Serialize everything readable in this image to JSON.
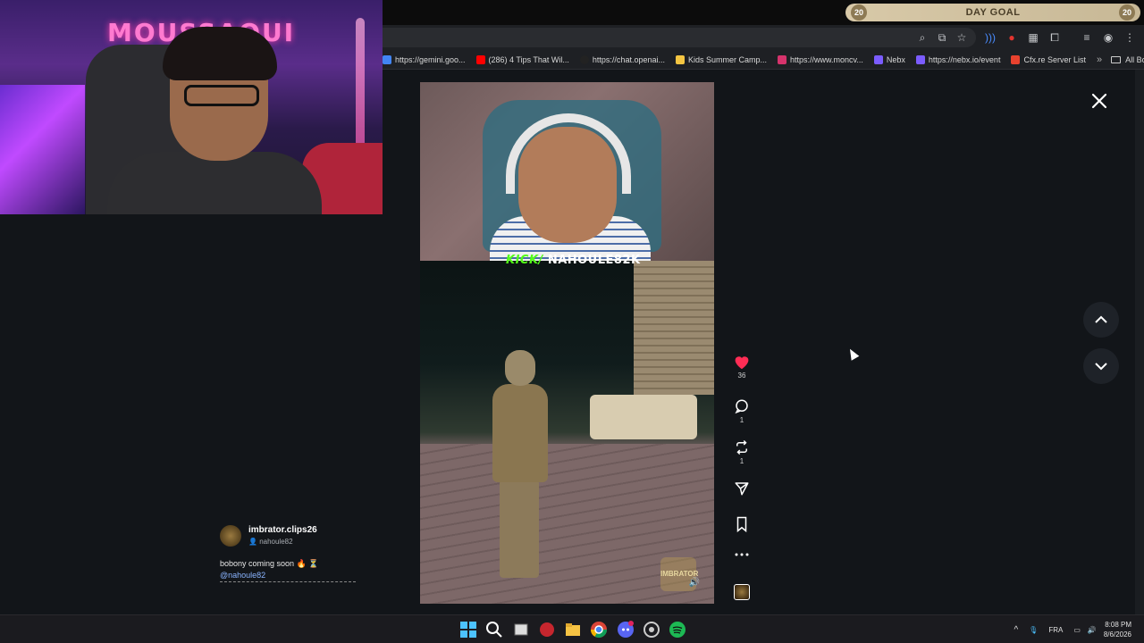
{
  "stream_overlay": {
    "brand": "MOUSSAOUI",
    "day_goal": {
      "label": "DAY GOAL",
      "left_value": "20",
      "right_value": "20",
      "progress": 1.0
    }
  },
  "bookmarks": {
    "items": [
      {
        "label": "https://gemini.goo...",
        "color": "#4285f4"
      },
      {
        "label": "(286) 4 Tips That Wil...",
        "color": "#ff0000"
      },
      {
        "label": "https://chat.openai...",
        "color": "#222222"
      },
      {
        "label": "Kids Summer Camp...",
        "color": "#f4c542"
      },
      {
        "label": "https://www.moncv...",
        "color": "#d6336c"
      },
      {
        "label": "Nebx",
        "color": "#7b5cff"
      },
      {
        "label": "https://nebx.io/event",
        "color": "#7b5cff"
      },
      {
        "label": "Cfx.re Server List",
        "color": "#e8422e"
      }
    ],
    "all_label": "All Bookmarks"
  },
  "video": {
    "overlay_prefix": "KICK/",
    "overlay_name": "NAHOULE82K",
    "watermark": "IMBRATOR CLIPS"
  },
  "actions": {
    "likes": "36",
    "comments": "1",
    "reposts": "1"
  },
  "post": {
    "handle": "imbrator.clips26",
    "sub": "nahoule82",
    "caption": "bobony coming soon 🔥 ⏳",
    "mention": "@nahoule82"
  },
  "taskbar": {
    "language": "FRA",
    "time": "8:08 PM",
    "date": "8/6/2026",
    "discord_badge": "94"
  },
  "colors": {
    "background": "#121519",
    "like": "#ff2d55",
    "kick_green": "#53fc18"
  }
}
